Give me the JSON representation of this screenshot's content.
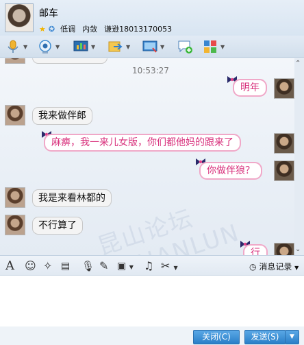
{
  "header": {
    "contact_name": "邮车",
    "status_label": "低调",
    "signature_parts": [
      "内敛",
      "谦逊18013170053"
    ]
  },
  "toolbar": {
    "icons": [
      "microphone-icon",
      "video-camera-icon",
      "screen-share-icon",
      "file-transfer-icon",
      "remote-desktop-icon",
      "add-chat-icon",
      "apps-icon"
    ]
  },
  "chat": {
    "timestamp": "10:53:27",
    "watermark": "昆山论坛 KSHANLUN",
    "messages": [
      {
        "side": "out",
        "text": "明年"
      },
      {
        "side": "in",
        "text": "我来做伴郎"
      },
      {
        "side": "out",
        "text": "麻痹，我一来儿女版，你们都他妈的跟来了"
      },
      {
        "side": "out",
        "text": "你做伴狼？"
      },
      {
        "side": "in",
        "text": "我是来看林都的"
      },
      {
        "side": "in",
        "text": "不行算了"
      },
      {
        "side": "out",
        "text": "行"
      }
    ]
  },
  "input_toolbar": {
    "icons": [
      "font-icon",
      "emoji-icon",
      "magic-wand-icon",
      "video-clip-icon",
      "voice-message-icon",
      "edit-icon",
      "image-icon",
      "music-icon",
      "screenshot-icon"
    ],
    "history_label": "消息记录"
  },
  "buttons": {
    "close_label": "关闭(C)",
    "send_label": "发送(S)"
  },
  "colors": {
    "outgoing_text": "#d8307c",
    "outgoing_border": "#f0a8c8",
    "button_blue": "#2a7fc8"
  }
}
